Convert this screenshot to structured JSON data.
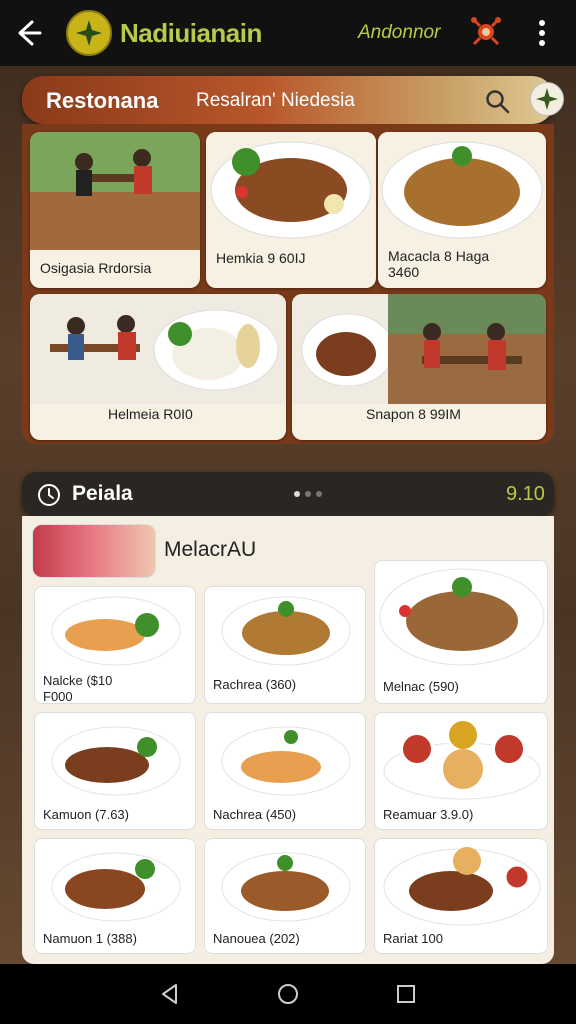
{
  "appbar": {
    "title": "Nadiuianain",
    "subtitle": "Andonnor",
    "icons": [
      "back-arrow-icon",
      "app-logo-icon",
      "bug-icon",
      "more-vert-icon"
    ]
  },
  "banner": {
    "title": "Restonana",
    "subtitle": "Resalran' Niedesia",
    "icons": [
      "search-icon",
      "restaurant-badge-icon"
    ]
  },
  "featured": [
    {
      "caption": "Osigasia Rrdorsia"
    },
    {
      "caption": "Hemkia 9 60IJ"
    },
    {
      "caption": "Macacla 8 Haga\n3460"
    },
    {
      "caption": "Helmeia R0I0"
    },
    {
      "caption": "Snapon 8 99IM"
    }
  ],
  "section": {
    "title": "Peiala",
    "price": "9.10",
    "icon": "clock-icon"
  },
  "menu": {
    "title": "MelacrAU",
    "items": [
      {
        "caption": "Nalcke ($10\nF000"
      },
      {
        "caption": "Rachrea (360)"
      },
      {
        "caption": "Melnac (590)"
      },
      {
        "caption": "Kamuon (7.63)"
      },
      {
        "caption": "Nachrea (450)"
      },
      {
        "caption": "Reamuar 3.9.0)"
      },
      {
        "caption": "Namuon 1 (388)"
      },
      {
        "caption": "Nanouea (202)"
      },
      {
        "caption": "Rariat 100"
      }
    ]
  },
  "navbar": {
    "icons": [
      "back-triangle-icon",
      "home-circle-icon",
      "recents-square-icon"
    ]
  },
  "colors": {
    "appbar_bg": "#111111",
    "accent_green": "#b9c94a",
    "banner_start": "#8a3a1a",
    "panel_bg": "#f4efe2"
  }
}
